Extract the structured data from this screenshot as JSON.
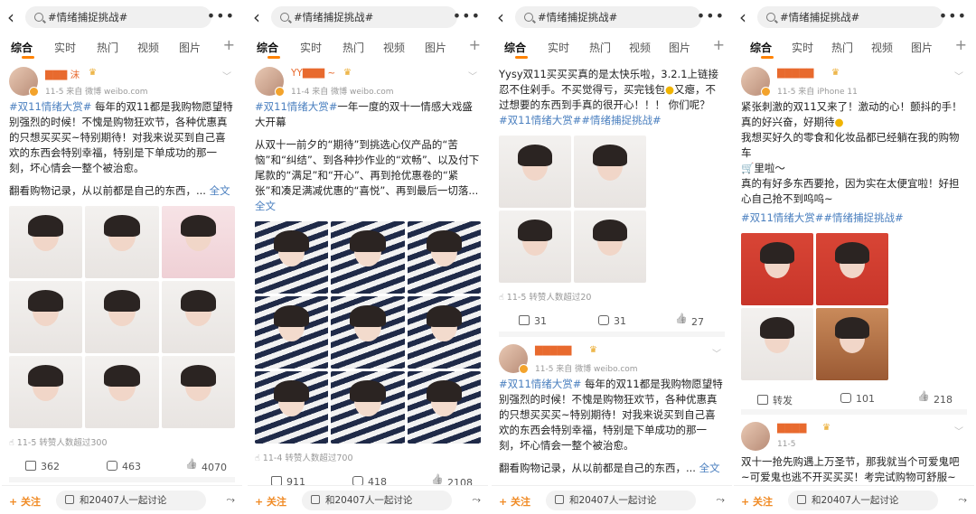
{
  "search_query": "#情绪捕捉挑战#",
  "tabs": [
    "综合",
    "实时",
    "热门",
    "视频",
    "图片"
  ],
  "bottom": {
    "follow": "+ 关注",
    "discuss": "和20407人一起讨论"
  },
  "panels": [
    {
      "post": {
        "user": "▇▇▇ 沫",
        "meta": "11-5  来自 微博  weibo.com",
        "tag": "#双11情绪大赏#",
        "text": " 每年的双11都是我购物愿望特别强烈的时候！不愧是购物狂欢节，各种优惠真的只想买买买~特别期待！对我来说买到自己喜欢的东西会特别幸福，特别是下单成功的那一刻，坏心情会一整个被治愈。",
        "text2": "翻看购物记录，从以前都是自己的东西，... ",
        "more": "全文",
        "likes": "11-5 转赞人数超过300",
        "repost": "362",
        "comment": "463",
        "like": "4070"
      }
    },
    {
      "post": {
        "user": "YY▇▇▇ ~",
        "meta": "11-4  来自 微博  weibo.com",
        "tag": "#双11情绪大赏#",
        "text": "一年一度的双十一情感大戏盛大开幕",
        "text2": "从双十一前夕的“期待”到挑选心仪产品的“苦恼”和“纠结”、到各种抄作业的“欢畅”、以及付下尾款的“满足”和“开心”、再到抢优惠卷的“紧张”和凑足满减优惠的“喜悦”、再到最后一切落... ",
        "more": "全文",
        "likes": "11-4 转赞人数超过700",
        "repost": "911",
        "comment": "418",
        "like": "2108"
      }
    },
    {
      "post": {
        "text": "Yysy双11买买买真的是太快乐啦，3.2.1上链接忍不住剁手。不买觉得亏，买完钱包",
        "text_b": "又瘪，不过想要的东西到手真的很开心！！！ 你们呢？",
        "tags": "#双11情绪大赏##情绪捕捉挑战#",
        "likes": "11-5 转赞人数超过20",
        "repost": "31",
        "comment": "31",
        "like": "27"
      },
      "post2": {
        "user": "▇▇▇▇▇",
        "meta": "11-5  来自 微博  weibo.com",
        "tag": "#双11情绪大赏#",
        "text": " 每年的双11都是我购物愿望特别强烈的时候！不愧是购物狂欢节，各种优惠真的只想买买买~特别期待！对我来说买到自己喜欢的东西会特别幸福，特别是下单成功的那一刻，坏心情会一整个被治愈。",
        "text2": "翻看购物记录，从以前都是自己的东西，... ",
        "more": "全文"
      }
    },
    {
      "post": {
        "user": "▇▇▇▇▇",
        "meta": "11-5  来自 iPhone 11",
        "text": "紧张刺激的双11又来了！激动的心！颤抖的手！真的好兴奋，好期待",
        "text2": "我想买好久的零食和化妆品都已经躺在我的购物车",
        "text3": "里啦～",
        "text4": "真的有好多东西要抢，因为实在太便宜啦！好担心自己抢不到呜呜~",
        "tags": "#双11情绪大赏##情绪捕捉挑战#",
        "repost": "转发",
        "comment": "101",
        "like": "218"
      },
      "post2": {
        "user": "▇▇▇▇",
        "meta": "11-5",
        "text": "双十一抢先购遇上万圣节，那我就当个可爱鬼吧~可爱鬼也逃不开买买买！考完试购物可舒服~"
      }
    }
  ]
}
